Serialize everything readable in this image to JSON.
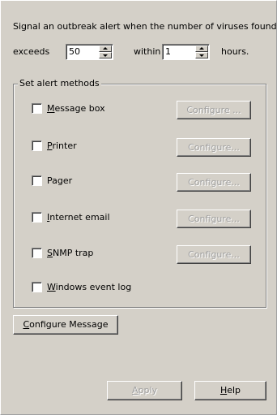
{
  "threshold": {
    "line1": "Signal an outbreak alert when the number of viruses found",
    "exceeds_label": "exceeds",
    "exceeds_value": "50",
    "within_label": "within",
    "within_value": "1",
    "hours_label": "hours."
  },
  "alert_methods": {
    "group_title": "Set alert methods",
    "items": [
      {
        "mnemonic": "M",
        "rest": "essage box",
        "configure": "Configure ...",
        "has_configure": true
      },
      {
        "mnemonic": "P",
        "rest": "rinter",
        "configure": "Configure...",
        "has_configure": true
      },
      {
        "mnemonic": "",
        "rest": "Pager",
        "configure": "Configure...",
        "has_configure": true
      },
      {
        "mnemonic": "I",
        "rest": "nternet email",
        "configure": "Configure...",
        "has_configure": true
      },
      {
        "mnemonic": "S",
        "rest": "NMP trap",
        "configure": "Configure...",
        "has_configure": true
      },
      {
        "mnemonic": "W",
        "rest": "indows event log",
        "has_configure": false
      }
    ]
  },
  "configure_message": {
    "mnemonic": "C",
    "rest": "onfigure Message"
  },
  "footer": {
    "apply": {
      "mnemonic": "A",
      "rest": "pply"
    },
    "help": {
      "mnemonic": "H",
      "rest": "elp"
    }
  }
}
